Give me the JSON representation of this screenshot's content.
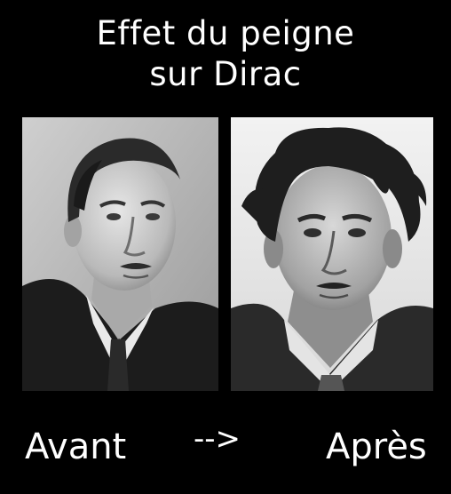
{
  "title": {
    "line1": "Effet du peigne",
    "line2": "sur Dirac"
  },
  "captions": {
    "before": "Avant",
    "arrow": "-->",
    "after": "Après"
  },
  "photos": {
    "before": {
      "style": "black-and-white portrait, tidy combed hair"
    },
    "after": {
      "style": "black-and-white portrait, tousled uncombed hair"
    }
  }
}
